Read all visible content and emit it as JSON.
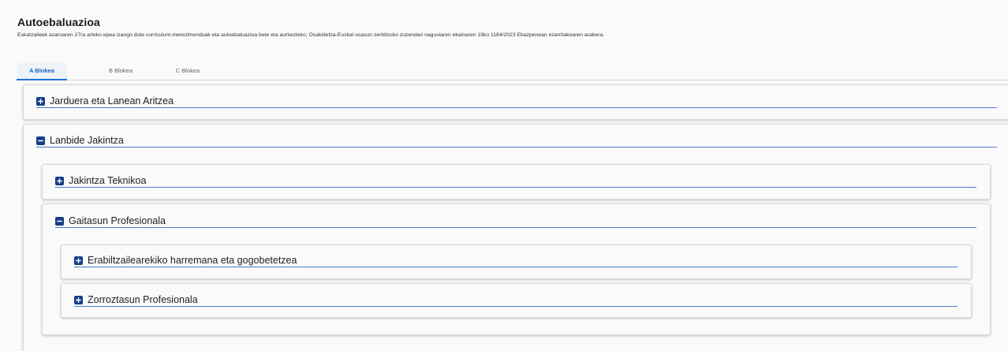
{
  "header": {
    "title": "Autoebaluazioa",
    "description": "Eskatzaileek azaroaren 27ra arteko epea izango dute curriculum-merezimenduak eta autoebaluazioa bete eta aurkezteko, Osakidetza-Euskal osasun zerbitzuko zuzendari nagusiaren ekainaren 19ko 1184/2023 Ebazpenean ezarritakoaren arabera."
  },
  "tabs": [
    {
      "label": "A Blokea",
      "active": true
    },
    {
      "label": "B Blokea",
      "active": false
    },
    {
      "label": "C Blokea",
      "active": false
    }
  ],
  "sections": {
    "jarduera": {
      "label": "Jarduera eta Lanean Aritzea",
      "state": "collapsed",
      "icon": "plus-square-icon"
    },
    "lanbide": {
      "label": "Lanbide Jakintza",
      "state": "expanded",
      "icon": "minus-square-icon"
    },
    "jakintza_teknikoa": {
      "label": "Jakintza Teknikoa",
      "state": "collapsed",
      "icon": "plus-square-icon"
    },
    "gaitasun": {
      "label": "Gaitasun Profesionala",
      "state": "expanded",
      "icon": "minus-square-icon"
    },
    "erabiltzaile": {
      "label": "Erabiltzailearekiko harremana eta gogobetetzea",
      "state": "collapsed",
      "icon": "plus-square-icon"
    },
    "zorroztasun": {
      "label": "Zorroztasun Profesionala",
      "state": "collapsed",
      "icon": "plus-square-icon"
    }
  },
  "colors": {
    "accent": "#1976d2",
    "icon_bg": "#153d8a",
    "underline": "#4a7cc7"
  }
}
